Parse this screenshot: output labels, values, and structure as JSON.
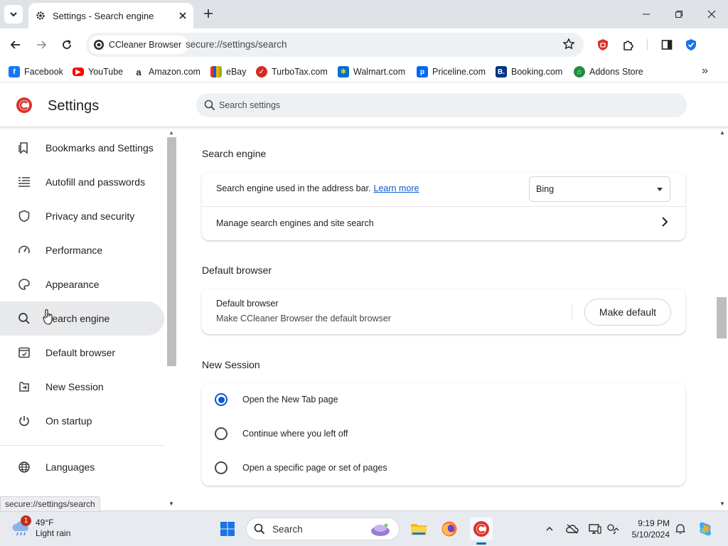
{
  "browser": {
    "tab": {
      "title": "Settings - Search engine"
    },
    "address": {
      "chip_label": "CCleaner Browser",
      "url": "secure://settings/search"
    },
    "bookmarks": [
      {
        "label": "Facebook",
        "icon": "facebook-icon",
        "color": "#1877f2"
      },
      {
        "label": "YouTube",
        "icon": "youtube-icon",
        "color": "#ff0000"
      },
      {
        "label": "Amazon.com",
        "icon": "amazon-icon",
        "color": "#222222"
      },
      {
        "label": "eBay",
        "icon": "ebay-icon",
        "color": "#e53238"
      },
      {
        "label": "TurboTax.com",
        "icon": "turbotax-icon",
        "color": "#d52b1e"
      },
      {
        "label": "Walmart.com",
        "icon": "walmart-icon",
        "color": "#0071ce"
      },
      {
        "label": "Priceline.com",
        "icon": "priceline-icon",
        "color": "#0068ef"
      },
      {
        "label": "Booking.com",
        "icon": "booking-icon",
        "color": "#003580"
      },
      {
        "label": "Addons Store",
        "icon": "addons-store-icon",
        "color": "#1e8e3e"
      }
    ]
  },
  "settings": {
    "title": "Settings",
    "search_placeholder": "Search settings",
    "nav": [
      {
        "label": "Bookmarks and Settings",
        "icon": "bookmarks-icon"
      },
      {
        "label": "Autofill and passwords",
        "icon": "autofill-icon"
      },
      {
        "label": "Privacy and security",
        "icon": "shield-icon"
      },
      {
        "label": "Performance",
        "icon": "speedometer-icon"
      },
      {
        "label": "Appearance",
        "icon": "palette-icon"
      },
      {
        "label": "Search engine",
        "icon": "search-icon",
        "active": true
      },
      {
        "label": "Default browser",
        "icon": "browser-window-icon"
      },
      {
        "label": "New Session",
        "icon": "new-session-icon"
      },
      {
        "label": "On startup",
        "icon": "power-icon"
      },
      {
        "label": "Languages",
        "icon": "globe-icon"
      }
    ],
    "status_url": "secure://settings/search",
    "sections": {
      "search_engine": {
        "title": "Search engine",
        "address_bar_label": "Search engine used in the address bar.",
        "learn_more": "Learn more",
        "selected_engine": "Bing",
        "manage_label": "Manage search engines and site search"
      },
      "default_browser": {
        "title": "Default browser",
        "row_title": "Default browser",
        "row_subtitle": "Make CCleaner Browser the default browser",
        "button": "Make default"
      },
      "new_session": {
        "title": "New Session",
        "options": [
          {
            "label": "Open the New Tab page",
            "checked": true
          },
          {
            "label": "Continue where you left off",
            "checked": false
          },
          {
            "label": "Open a specific page or set of pages",
            "checked": false
          }
        ]
      }
    }
  },
  "taskbar": {
    "weather": {
      "badge": "1",
      "temp": "49°F",
      "condition": "Light rain"
    },
    "search_label": "Search",
    "time": "9:19 PM",
    "date": "5/10/2024"
  },
  "colors": {
    "accent": "#0b57d0",
    "brand_red": "#d9342b",
    "active_nav": "#e8e9eb"
  }
}
